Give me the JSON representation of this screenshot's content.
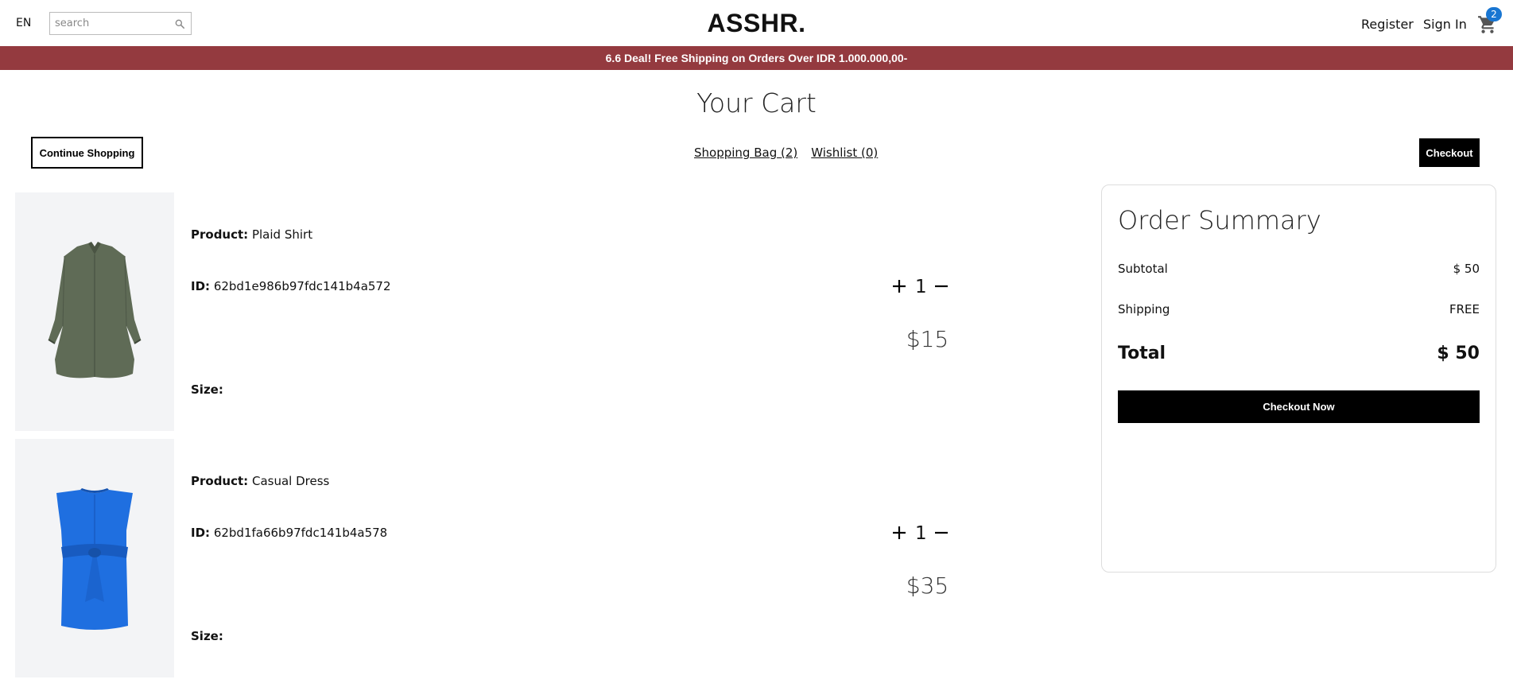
{
  "header": {
    "language": "EN",
    "search_placeholder": "search",
    "logo": "ASSHR.",
    "register": "Register",
    "sign_in": "Sign In",
    "cart_count": "2",
    "cart_icon": "cart-icon",
    "search_icon": "search-icon"
  },
  "banner": {
    "text": "6.6 Deal! Free Shipping on Orders Over IDR 1.000.000,00-",
    "color": "#943a3f"
  },
  "cart": {
    "title": "Your Cart",
    "continue_label": "Continue Shopping",
    "shopping_bag_label": "Shopping Bag (2)",
    "wishlist_label": "Wishlist (0)",
    "checkout_label": "Checkout",
    "items": [
      {
        "product_label": "Product:",
        "product_name": "Plaid Shirt",
        "id_label": "ID:",
        "id": "62bd1e986b97fdc141b4a572",
        "size_label": "Size:",
        "quantity": "1",
        "price": "$15",
        "image": "olive-shirt-image"
      },
      {
        "product_label": "Product:",
        "product_name": "Casual Dress",
        "id_label": "ID:",
        "id": "62bd1fa66b97fdc141b4a578",
        "size_label": "Size:",
        "quantity": "1",
        "price": "$35",
        "image": "blue-dress-image"
      }
    ]
  },
  "summary": {
    "title": "Order Summary",
    "subtotal_label": "Subtotal",
    "subtotal_value": "$ 50",
    "shipping_label": "Shipping",
    "shipping_value": "FREE",
    "total_label": "Total",
    "total_value": "$ 50",
    "checkout_now_label": "Checkout Now"
  }
}
